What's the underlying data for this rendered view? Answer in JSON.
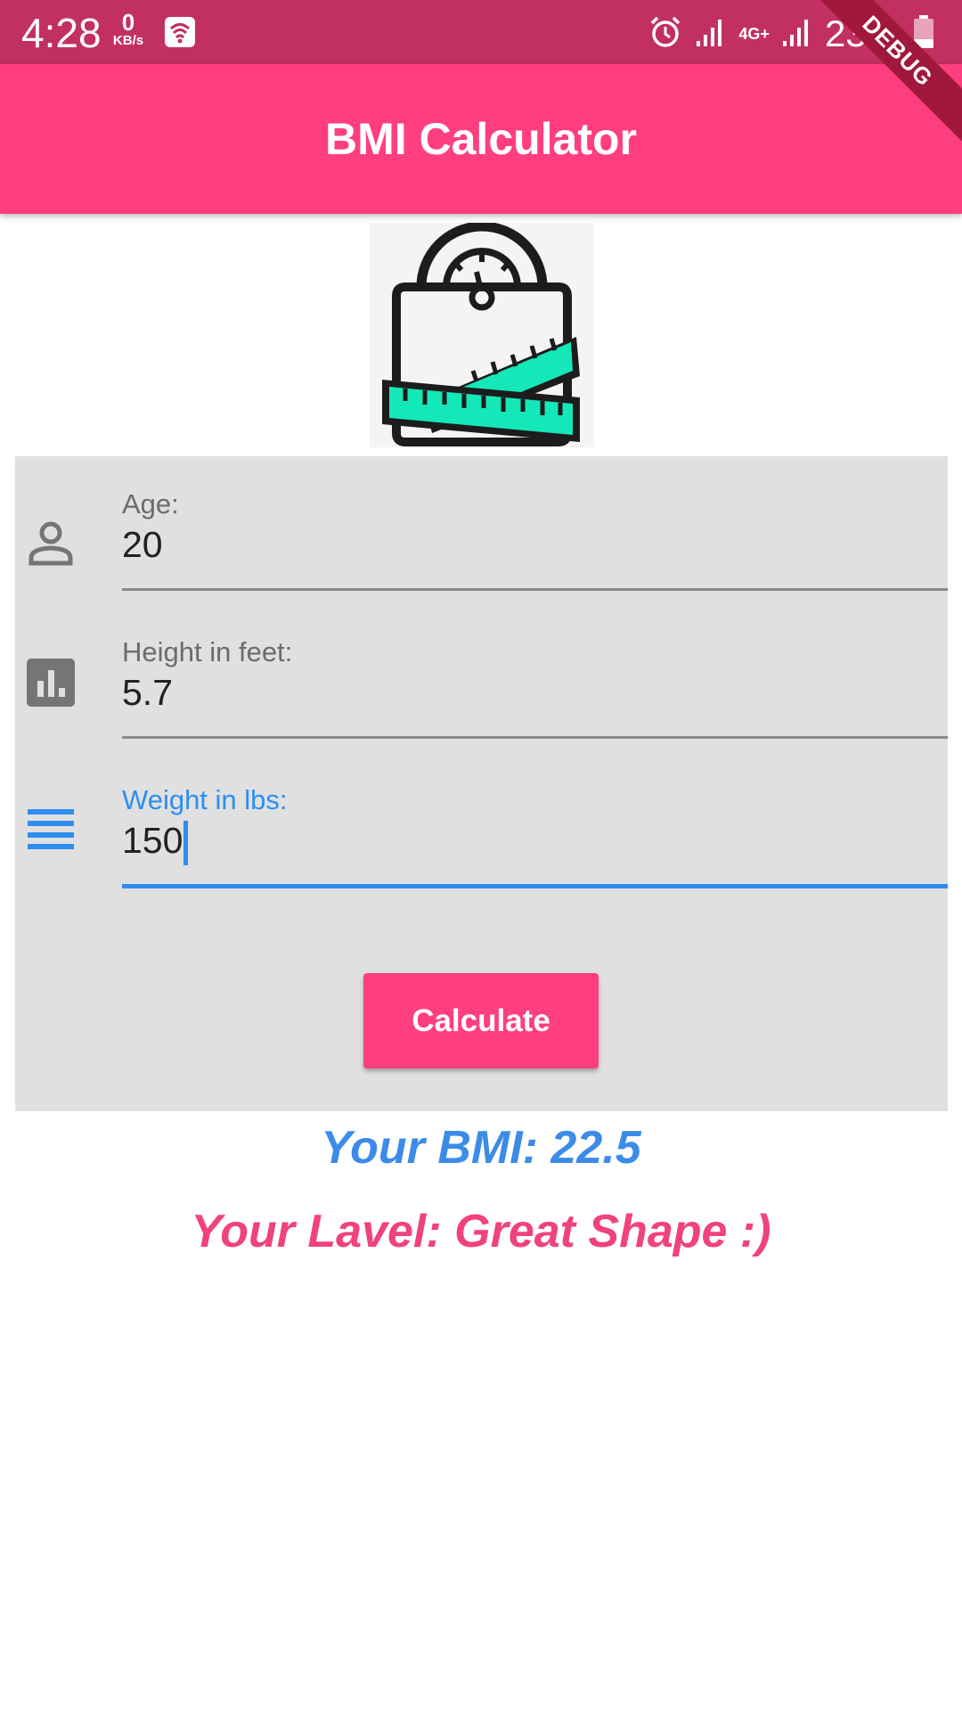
{
  "status_bar": {
    "time": "4:28",
    "net_speed_value": "0",
    "net_speed_unit": "KB/s",
    "network_type": "4G+",
    "battery": "23%"
  },
  "debug_banner": "DEBUG",
  "app_bar": {
    "title": "BMI Calculator"
  },
  "hero": {
    "icon": "scale-measuring-tape-icon"
  },
  "form": {
    "age": {
      "label": "Age:",
      "value": "20",
      "icon": "person-icon"
    },
    "height": {
      "label": "Height in feet:",
      "value": "5.7",
      "icon": "bar-chart-icon"
    },
    "weight": {
      "label": "Weight in lbs:",
      "value": "150",
      "icon": "lines-icon"
    },
    "calculate_label": "Calculate"
  },
  "results": {
    "bmi": "Your BMI: 22.5",
    "level": "Your Lavel: Great Shape :)"
  },
  "colors": {
    "primary": "#ff3f7d",
    "status_bar": "#c2305f",
    "accent_blue": "#2d8ef0",
    "form_bg": "#e0e0e0"
  }
}
